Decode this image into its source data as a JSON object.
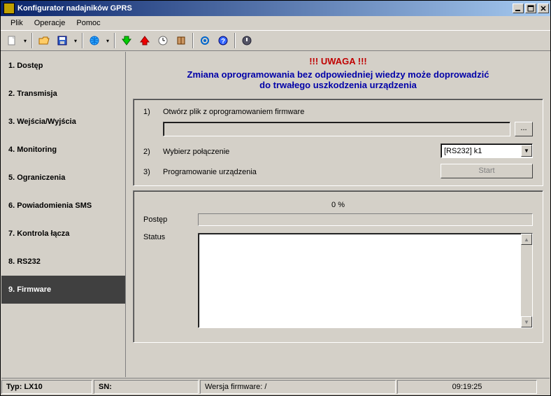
{
  "title": "Konfigurator nadajników GPRS",
  "menu": {
    "plik": "Plik",
    "operacje": "Operacje",
    "pomoc": "Pomoc"
  },
  "sidebar": {
    "items": [
      {
        "label": "1. Dostęp"
      },
      {
        "label": "2. Transmisja"
      },
      {
        "label": "3. Wejścia/Wyjścia"
      },
      {
        "label": "4. Monitoring"
      },
      {
        "label": "5. Ograniczenia"
      },
      {
        "label": "6. Powiadomienia SMS"
      },
      {
        "label": "7. Kontrola łącza"
      },
      {
        "label": "8. RS232"
      },
      {
        "label": "9. Firmware"
      }
    ],
    "active_index": 8
  },
  "warning": {
    "title": "!!! UWAGA !!!",
    "line1": "Zmiana oprogramowania bez odpowiedniej wiedzy może doprowadzić",
    "line2": "do trwałego uszkodzenia urządzenia"
  },
  "steps": {
    "s1_num": "1)",
    "s1_label": "Otwórz plik z oprogramowaniem firmware",
    "file_value": "",
    "browse_label": "...",
    "s2_num": "2)",
    "s2_label": "Wybierz połączenie",
    "connection_selected": "[RS232] k1",
    "s3_num": "3)",
    "s3_label": "Programowanie urządzenia",
    "start_label": "Start"
  },
  "progress": {
    "percent": "0 %",
    "progress_label": "Postęp",
    "status_label": "Status",
    "status_text": ""
  },
  "statusbar": {
    "type": "Typ: LX10",
    "sn": "SN:",
    "fw": "Wersja firmware: /",
    "time": "09:19:25"
  },
  "colors": {
    "warn_title": "#c00000",
    "warn_body": "#0000a8",
    "win_bg": "#d4d0c8"
  }
}
